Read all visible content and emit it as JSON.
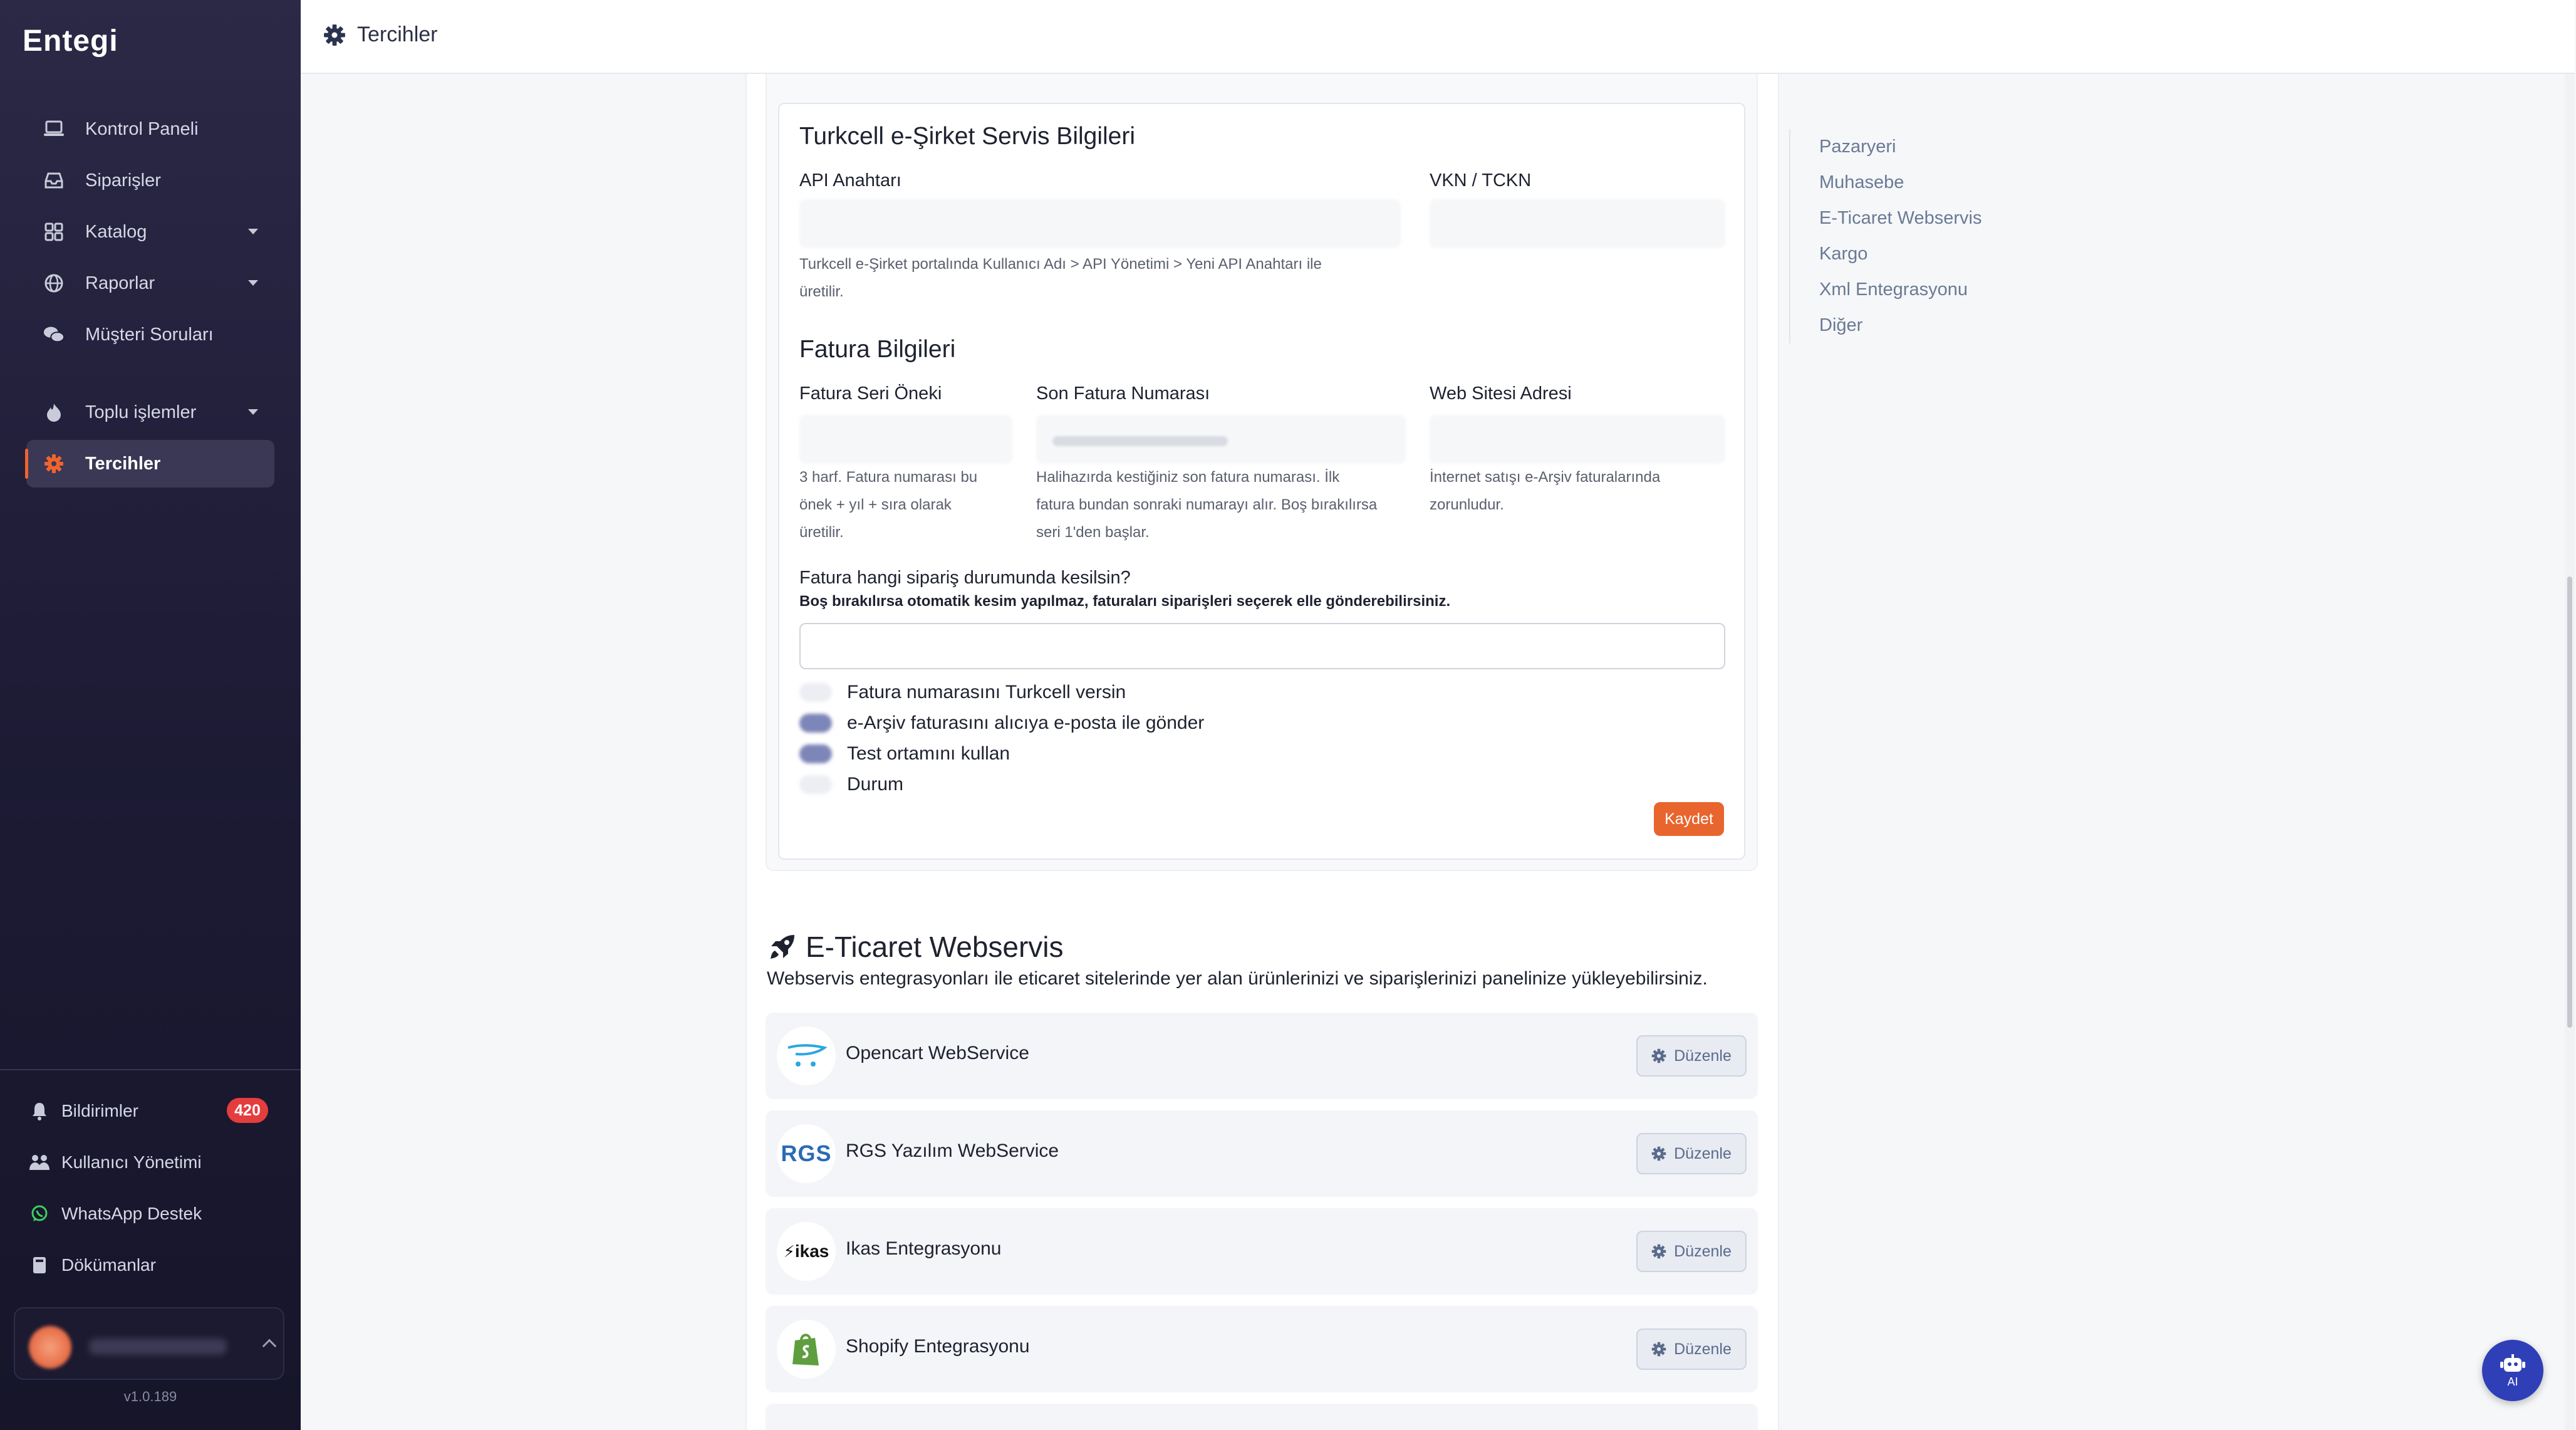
{
  "app": {
    "logo": "Entegi",
    "version": "v1.0.189"
  },
  "topbar": {
    "title": "Tercihler",
    "icon": "gear-icon"
  },
  "sidebar": {
    "items": [
      {
        "label": "Kontrol Paneli",
        "icon": "laptop-icon"
      },
      {
        "label": "Siparişler",
        "icon": "inbox-icon"
      },
      {
        "label": "Katalog",
        "icon": "grid-icon",
        "has_caret": true
      },
      {
        "label": "Raporlar",
        "icon": "globe-icon",
        "has_caret": true
      },
      {
        "label": "Müşteri Soruları",
        "icon": "chat-icon"
      },
      {
        "label": "Toplu işlemler",
        "icon": "fire-icon",
        "has_caret": true
      },
      {
        "label": "Tercihler",
        "icon": "gear-icon",
        "active": true
      }
    ],
    "footer": [
      {
        "label": "Bildirimler",
        "icon": "bell-icon",
        "badge": "420"
      },
      {
        "label": "Kullanıcı Yönetimi",
        "icon": "users-icon"
      },
      {
        "label": "WhatsApp Destek",
        "icon": "whatsapp-icon"
      },
      {
        "label": "Dökümanlar",
        "icon": "book-icon"
      }
    ]
  },
  "turkcell": {
    "title": "Turkcell e-Şirket Servis Bilgileri",
    "api_label": "API Anahtarı",
    "vkn_label": "VKN / TCKN",
    "api_help_1": "Turkcell e-Şirket portalında Kullanıcı Adı > API Yönetimi > Yeni API Anahtarı ile",
    "api_help_2": "üretilir."
  },
  "fatura": {
    "title": "Fatura Bilgileri",
    "seri_label": "Fatura Seri Öneki",
    "son_label": "Son Fatura Numarası",
    "web_label": "Web Sitesi Adresi",
    "seri_help": [
      "3 harf. Fatura numarası bu",
      "önek + yıl + sıra olarak",
      "üretilir."
    ],
    "son_help": [
      "Halihazırda kestiğiniz son fatura numarası. İlk",
      "fatura bundan sonraki numarayı alır. Boş bırakılırsa",
      "seri 1'den başlar."
    ],
    "web_help": [
      "İnternet satışı e-Arşiv faturalarında",
      "zorunludur."
    ],
    "status_question": "Fatura hangi sipariş durumunda kesilsin?",
    "status_note": "Boş bırakılırsa otomatik kesim yapılmaz, faturaları siparişleri seçerek elle gönderebilirsiniz.",
    "options": [
      {
        "label": "Fatura numarasını Turkcell versin",
        "checked": false
      },
      {
        "label": "e-Arşiv faturasını alıcıya e-posta ile gönder",
        "checked": true
      },
      {
        "label": "Test ortamını kullan",
        "checked": true
      },
      {
        "label": "Durum",
        "checked": false
      }
    ],
    "save_label": "Kaydet"
  },
  "eticaret": {
    "title": "E-Ticaret Webservis",
    "description": "Webservis entegrasyonları ile eticaret sitelerinde yer alan ürünlerinizi ve siparişlerinizi panelinize yükleyebilirsiniz.",
    "edit_label": "Düzenle",
    "services": [
      {
        "name": "Opencart WebService",
        "logo": "opencart-logo"
      },
      {
        "name": "RGS Yazılım WebService",
        "logo": "rgs-logo",
        "logo_text": "RGS"
      },
      {
        "name": "Ikas Entegrasyonu",
        "logo": "ikas-logo",
        "logo_text": "ikas"
      },
      {
        "name": "Shopify Entegrasyonu",
        "logo": "shopify-logo"
      }
    ]
  },
  "toc": [
    "Pazaryeri",
    "Muhasebe",
    "E-Ticaret Webservis",
    "Kargo",
    "Xml Entegrasyonu",
    "Diğer"
  ],
  "ai_button": {
    "label": "AI"
  },
  "colors": {
    "accent": "#e8652e",
    "sidebar_bg": "#1e1c36",
    "link": "#6a7a94",
    "ai": "#2f3fb7"
  }
}
